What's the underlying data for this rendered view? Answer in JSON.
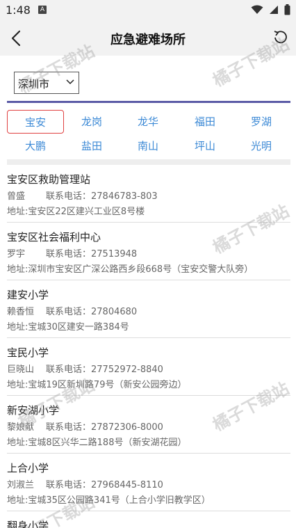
{
  "status": {
    "time": "1:48",
    "notif_letter": "A"
  },
  "nav": {
    "title": "应急避难场所"
  },
  "city_select": {
    "value": "深圳市"
  },
  "districts": [
    "宝安",
    "龙岗",
    "龙华",
    "福田",
    "罗湖",
    "大鹏",
    "盐田",
    "南山",
    "坪山",
    "光明"
  ],
  "active_district": "宝安",
  "shelters": [
    {
      "name": "宝安区救助管理站",
      "contact": "曾盛",
      "phone": "联系电话：27846783-803",
      "address": "地址:宝安区22区建兴工业区8号楼"
    },
    {
      "name": "宝安区社会福利中心",
      "contact": "罗宇",
      "phone": "联系电话：27513948",
      "address": "地址:深圳市宝安区广深公路西乡段668号（宝安交警大队旁）"
    },
    {
      "name": "建安小学",
      "contact": "赖香恒",
      "phone": "联系电话：27804680",
      "address": "地址:宝城30区建安一路384号"
    },
    {
      "name": "宝民小学",
      "contact": "巨晓山",
      "phone": "联系电话：27752972-8840",
      "address": "地址:宝城19区新圳路79号（新安公园旁边）"
    },
    {
      "name": "新安湖小学",
      "contact": "黎娘献",
      "phone": "联系电话：27872306-8000",
      "address": "地址:宝城8区兴华二路188号（新安湖花园）"
    },
    {
      "name": "上合小学",
      "contact": "刘淑兰",
      "phone": "联系电话：27968445-8110",
      "address": "地址:宝城35区公园路341号（上合小学旧教学区）"
    },
    {
      "name": "翻身小学",
      "contact": "",
      "phone": "",
      "address": ""
    }
  ],
  "watermark_text": "橘子下载站"
}
